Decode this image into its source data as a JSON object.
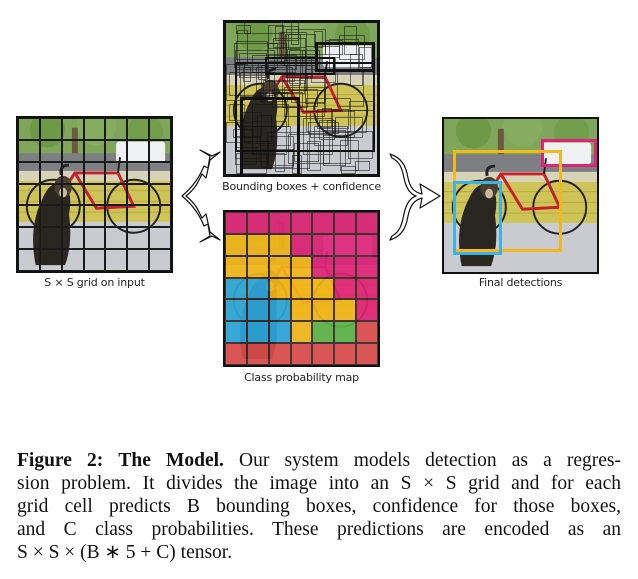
{
  "figure": {
    "panels": {
      "input": {
        "label": "S × S grid on input",
        "grid_size": 7
      },
      "boxes": {
        "label": "Bounding boxes + confidence"
      },
      "class_map": {
        "label": "Class probability map",
        "grid_size": 7,
        "colors": {
          "P": "#e0237a",
          "Y": "#f2b619",
          "B": "#2ca6dc",
          "G": "#5cb346",
          "R": "#dc4b4b"
        },
        "cells": [
          [
            "P",
            "P",
            "P",
            "P",
            "P",
            "P",
            "P"
          ],
          [
            "Y",
            "Y",
            "Y",
            "P",
            "P",
            "P",
            "P"
          ],
          [
            "Y",
            "Y",
            "Y",
            "Y",
            "P",
            "P",
            "P"
          ],
          [
            "B",
            "B",
            "Y",
            "Y",
            "Y",
            "P",
            "P"
          ],
          [
            "B",
            "B",
            "B",
            "Y",
            "Y",
            "Y",
            "P"
          ],
          [
            "B",
            "B",
            "B",
            "Y",
            "G",
            "G",
            "R"
          ],
          [
            "R",
            "R",
            "R",
            "R",
            "R",
            "R",
            "R"
          ]
        ]
      },
      "detections": {
        "label": "Final detections",
        "boxes": [
          {
            "object": "car",
            "color": "#e0237a"
          },
          {
            "object": "bicycle",
            "color": "#f5b81c"
          },
          {
            "object": "dog",
            "color": "#3bb4e5"
          }
        ]
      }
    },
    "caption": {
      "label": "Figure 2:",
      "title": "The Model.",
      "lines": [
        " Our system models detection as a regres-",
        "sion problem. It divides the image into an S × S grid and for each",
        "grid cell predicts B bounding boxes, confidence for those boxes,",
        "and C class probabilities.  These predictions are encoded as an",
        "S × S × (B ∗ 5 + C) tensor."
      ]
    }
  }
}
